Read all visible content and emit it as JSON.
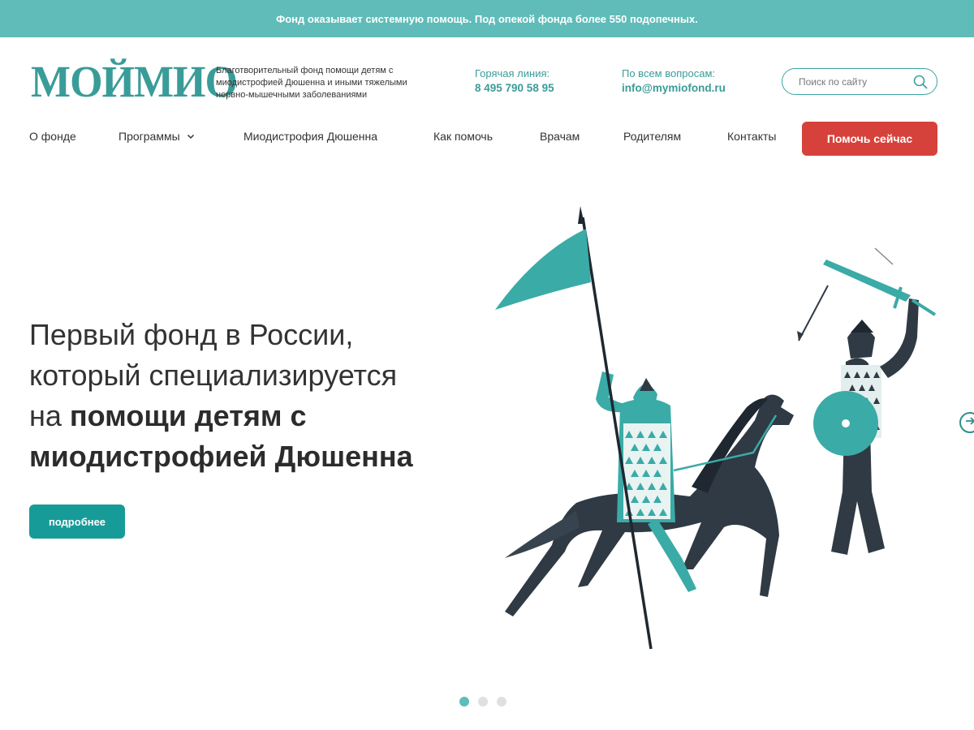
{
  "topbar": {
    "text": "Фонд оказывает системную помощь. Под опекой фонда более 550 подопечных."
  },
  "header": {
    "logo": "МОЙМИО",
    "tagline": "Благотворительный фонд помощи детям с миодистрофией Дюшенна и иными тяжелыми нервно-мышечными заболеваниями",
    "hotline_label": "Горячая линия:",
    "hotline_value": "8 495 790 58 95",
    "email_label": "По всем вопросам:",
    "email_value": "info@mymiofond.ru",
    "search_placeholder": "Поиск по сайту",
    "search_icon": "search-icon"
  },
  "nav": {
    "items": [
      {
        "label": "О фонде"
      },
      {
        "label": "Программы",
        "has_dropdown": true
      },
      {
        "label": "Миодистрофия Дюшенна"
      },
      {
        "label": "Как помочь"
      },
      {
        "label": "Врачам"
      },
      {
        "label": "Родителям"
      },
      {
        "label": "Контакты"
      }
    ],
    "cta_label": "Помочь сейчас"
  },
  "hero": {
    "title_line1": "Первый фонд в России,",
    "title_line2": "который специализируется",
    "title_line3_regular": "на ",
    "title_line3_bold": "помощи детям с",
    "title_line4_bold": "миодистрофией Дюшенна",
    "button_label": "подробнее"
  },
  "slider": {
    "total": 3,
    "active": 1,
    "next_icon": "arrow-right-circle-icon"
  },
  "colors": {
    "teal": "#5fbcb9",
    "teal_dark": "#179b98",
    "logo_teal": "#3a9c98",
    "red": "#d6423b",
    "dark_figure": "#2f3a44"
  }
}
